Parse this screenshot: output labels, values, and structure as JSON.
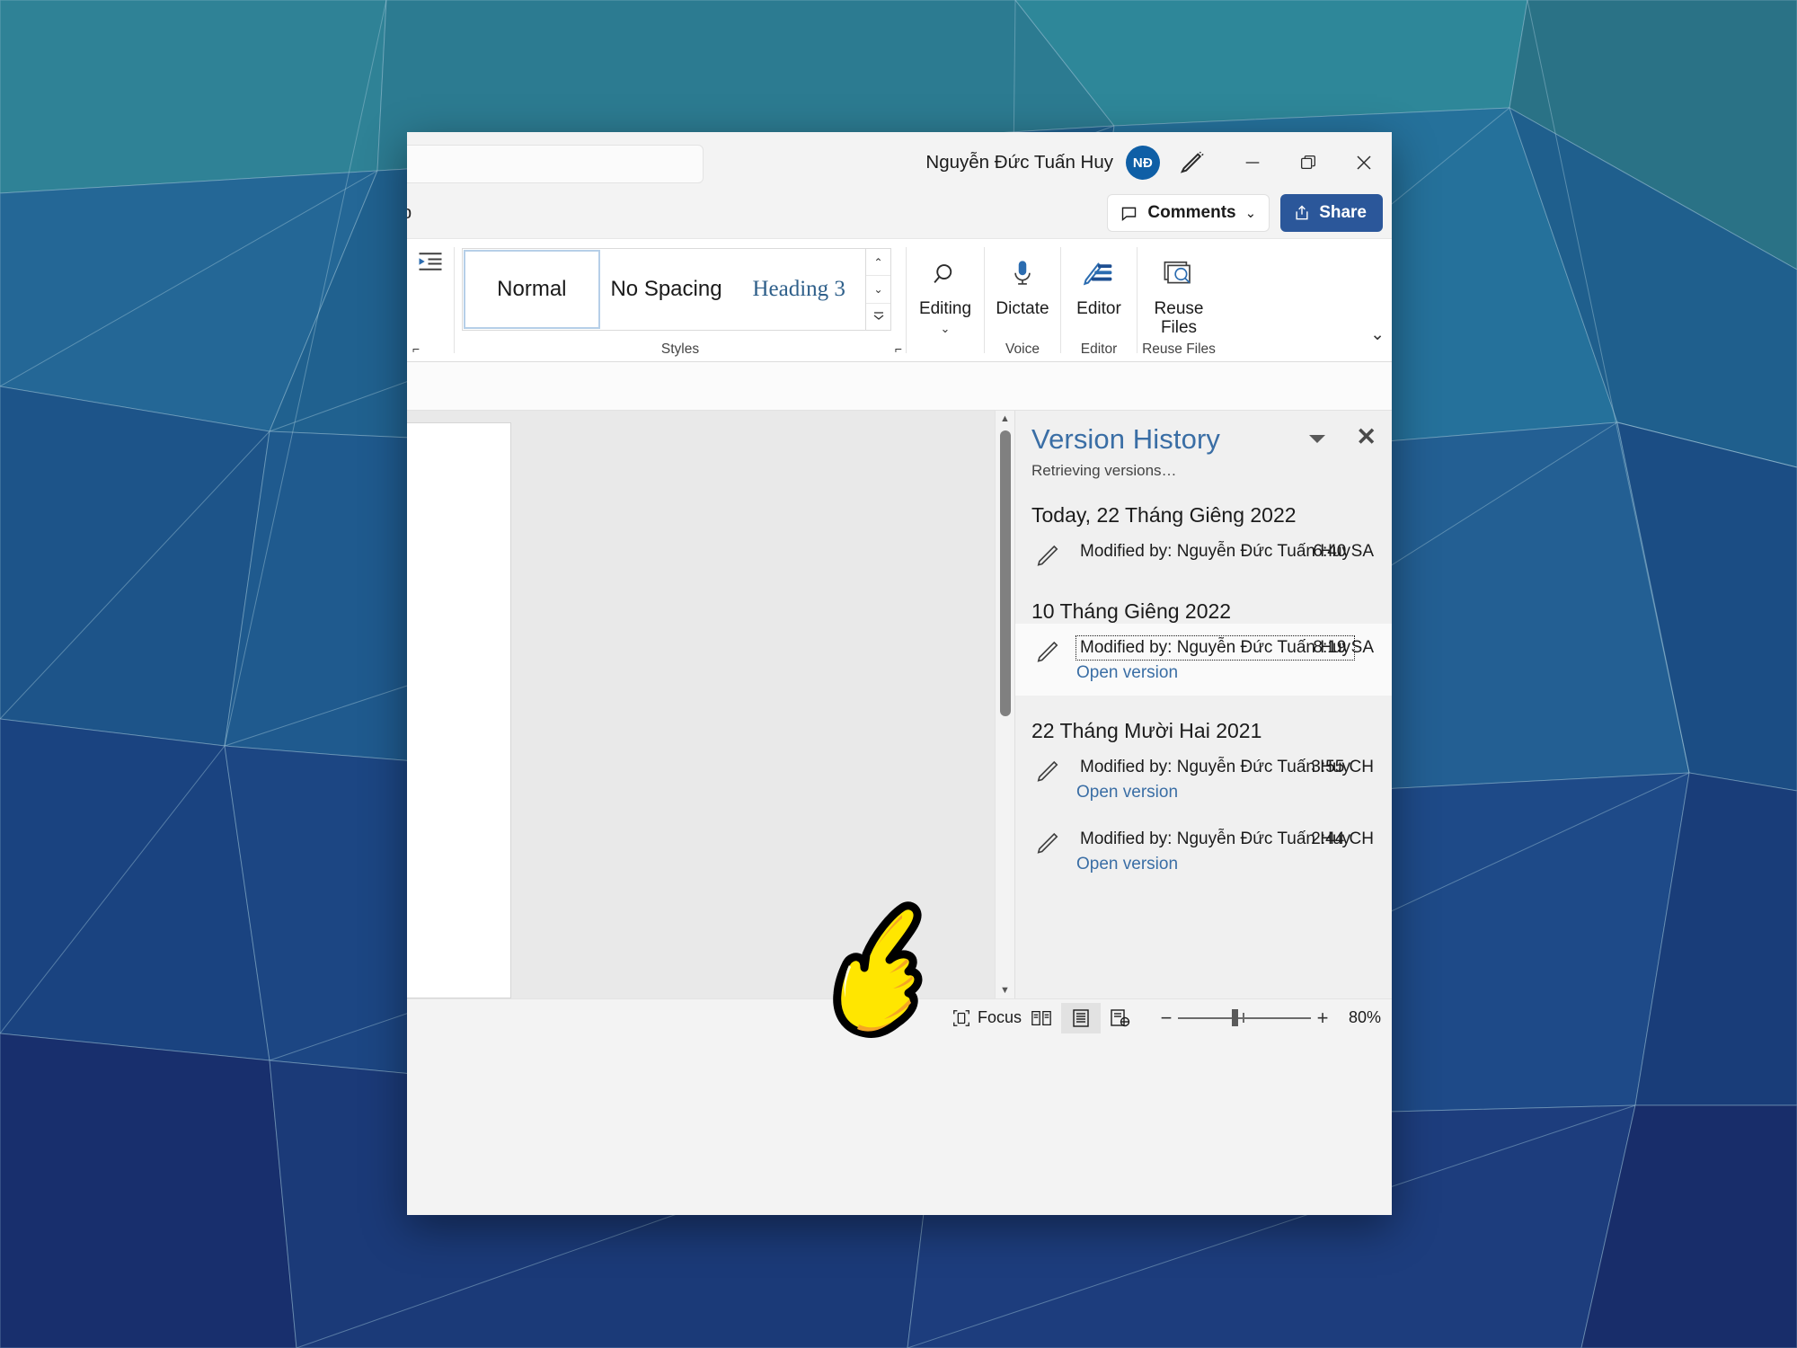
{
  "window": {
    "titlebar": {
      "search_placeholder": "",
      "user_name": "Nguyễn Đức Tuấn Huy",
      "avatar_initials": "NĐ",
      "ink_icon": "pen-ink-icon",
      "minimize_icon": "minimize-icon",
      "restore_icon": "restore-icon",
      "close_icon": "close-icon"
    },
    "tabs": {
      "clipped_tab_label": "p",
      "comments_label": "Comments",
      "comments_icon": "comment-bubble-icon",
      "comments_chevron": "⌄",
      "share_label": "Share",
      "share_icon": "share-icon"
    },
    "ribbon": {
      "styles": {
        "group_label": "Styles",
        "items": [
          {
            "label": "Normal",
            "selected": true
          },
          {
            "label": "No Spacing",
            "selected": false
          },
          {
            "label": "Heading 3",
            "selected": false
          }
        ],
        "scroll_up": "⌃",
        "scroll_down": "⌄",
        "scroll_more": "more-styles-icon"
      },
      "buttons": [
        {
          "name": "editing",
          "label": "Editing",
          "icon": "search-icon",
          "group_label": "",
          "has_chevron": true
        },
        {
          "name": "dictate",
          "label": "Dictate",
          "icon": "microphone-icon",
          "group_label": "Voice",
          "has_chevron": false
        },
        {
          "name": "editor",
          "label": "Editor",
          "icon": "editor-pen-icon",
          "group_label": "Editor",
          "has_chevron": false
        },
        {
          "name": "reuse-files",
          "label": "Reuse Files",
          "icon": "reuse-files-icon",
          "group_label": "Reuse Files",
          "has_chevron": false
        }
      ],
      "collapse_icon": "chevron-down-icon"
    },
    "version_history": {
      "title": "Version History",
      "status": "Retrieving versions…",
      "dropdown_icon": "dropdown-triangle-icon",
      "close_icon": "close-icon",
      "open_version_label": "Open version",
      "groups": [
        {
          "date": "Today, 22 Tháng Giêng 2022",
          "entries": [
            {
              "text": "Modified by: Nguyễn Đức Tuấn Huy",
              "time": "6:40 SA",
              "selected": false,
              "show_open_link": false
            }
          ]
        },
        {
          "date": "10 Tháng Giêng 2022",
          "entries": [
            {
              "text": "Modified by: Nguyễn Đức Tuấn Huy",
              "time": "8:19 SA",
              "selected": true,
              "show_open_link": true
            }
          ]
        },
        {
          "date": "22 Tháng Mười Hai 2021",
          "entries": [
            {
              "text": "Modified by: Nguyễn Đức Tuấn Huy",
              "time": "3:55 CH",
              "selected": false,
              "show_open_link": true
            },
            {
              "text": "Modified by: Nguyễn Đức Tuấn Huy",
              "time": "2:44 CH",
              "selected": false,
              "show_open_link": true
            }
          ]
        }
      ]
    },
    "statusbar": {
      "focus_label": "Focus",
      "focus_icon": "focus-mode-icon",
      "read_mode_icon": "read-mode-icon",
      "print_layout_icon": "print-layout-icon",
      "web_layout_icon": "web-layout-icon",
      "zoom_out": "−",
      "zoom_in": "+",
      "zoom_level": "80%"
    }
  },
  "cursor": {
    "type": "pointing-hand-cursor",
    "fill": "#ffe600",
    "shade": "#f5a623"
  },
  "colors": {
    "accent_blue": "#2b579a",
    "pane_title": "#3a6ea5",
    "link": "#3a6ea5",
    "avatar_bg": "#0f5fa6",
    "wallpaper_teal": "#2a7f93",
    "wallpaper_navy": "#1b3a7a"
  }
}
